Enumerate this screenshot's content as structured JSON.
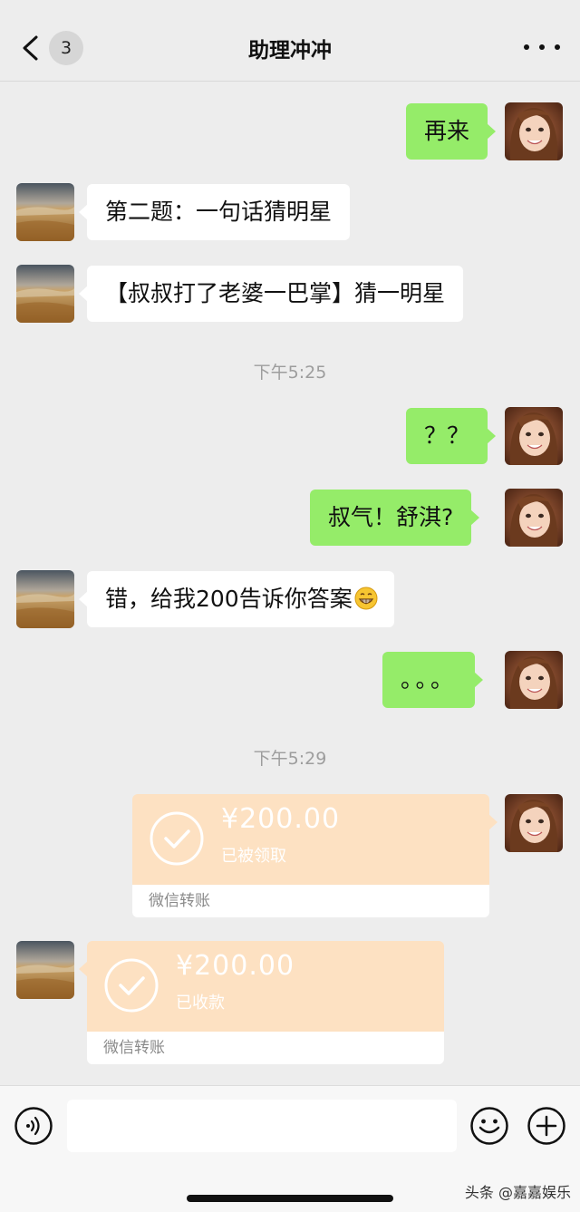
{
  "header": {
    "unread_count": "3",
    "title": "助理冲冲"
  },
  "messages": [
    {
      "side": "right",
      "text": "再来"
    },
    {
      "side": "left",
      "text": "第二题：一句话猜明星"
    },
    {
      "side": "left",
      "text": "【叔叔打了老婆一巴掌】猜一明星"
    },
    {
      "type": "time",
      "text": "下午5:25"
    },
    {
      "side": "right",
      "text": "？？"
    },
    {
      "side": "right",
      "text": "叔气！舒淇?"
    },
    {
      "side": "left",
      "text": "错，给我200告诉你答案"
    },
    {
      "side": "right",
      "text": "。。。"
    },
    {
      "type": "time",
      "text": "下午5:29"
    }
  ],
  "transfers": [
    {
      "side": "right",
      "amount": "¥200.00",
      "status": "已被领取",
      "label": "微信转账"
    },
    {
      "side": "left",
      "amount": "¥200.00",
      "status": "已收款",
      "label": "微信转账"
    }
  ],
  "input": {
    "placeholder": ""
  },
  "watermark": "头条 @嘉嘉娱乐",
  "colors": {
    "self_bubble": "#95ec69",
    "other_bubble": "#ffffff",
    "transfer_card": "#fde1c2",
    "background": "#ededed"
  },
  "icons": [
    "back-arrow-icon",
    "more-dots-icon",
    "voice-icon",
    "emoji-icon",
    "plus-icon",
    "check-circle-icon",
    "grin-emoji-icon"
  ]
}
